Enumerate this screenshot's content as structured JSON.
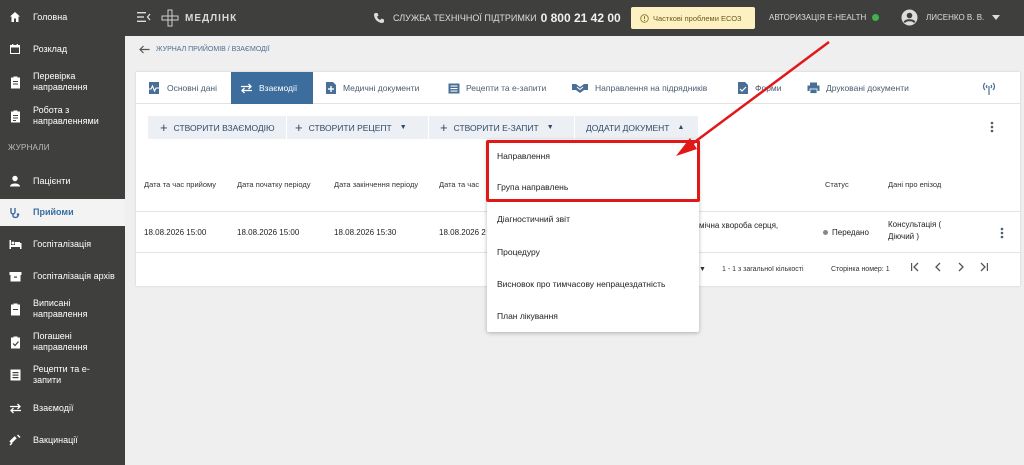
{
  "app": {
    "name": "МЕДЛІНК"
  },
  "sidebar": {
    "items": [
      {
        "label": "Головна",
        "icon": "home-icon"
      },
      {
        "label": "Розклад",
        "icon": "calendar-icon"
      },
      {
        "label": "Перевірка\nнаправлення",
        "icon": "clipboard-icon"
      },
      {
        "label": "Робота з\nнаправленнями",
        "icon": "clipboard-list-icon"
      },
      {
        "label": "Пацієнти",
        "icon": "person-icon"
      },
      {
        "label": "Прийоми",
        "icon": "stethoscope-icon"
      },
      {
        "label": "Госпіталізація",
        "icon": "bed-icon"
      },
      {
        "label": "Госпіталізація архів",
        "icon": "archive-icon"
      },
      {
        "label": "Виписані\nнаправлення",
        "icon": "clipboard-icon"
      },
      {
        "label": "Погашені\nнаправлення",
        "icon": "clipboard-check-icon"
      },
      {
        "label": "Рецепти та е-\nзапити",
        "icon": "list-icon"
      },
      {
        "label": "Взаємодії",
        "icon": "swap-icon"
      },
      {
        "label": "Вакцинації",
        "icon": "syringe-icon"
      }
    ],
    "section_journals": "ЖУРНАЛИ",
    "active_label": "Прийоми"
  },
  "topbar": {
    "support_label": "СЛУЖБА ТЕХНІЧНОЇ ПІДТРИМКИ",
    "phone": "0 800 21 42 00",
    "warning": "Часткові проблеми ЕСОЗ",
    "auth": "АВТОРИЗАЦІЯ E-HEALTH",
    "user": "ЛИСЕНКО В. В."
  },
  "breadcrumb": "ЖУРНАЛ ПРИЙОМІВ / ВЗАЄМОДІЇ",
  "tabs": [
    {
      "label": "Основні дані",
      "icon": "pulse-doc-icon"
    },
    {
      "label": "Взаємодії",
      "icon": "swap-icon",
      "active": true
    },
    {
      "label": "Медичні документи",
      "icon": "medical-doc-icon"
    },
    {
      "label": "Рецепти та е-запити",
      "icon": "list-icon"
    },
    {
      "label": "Направлення на підрядників",
      "icon": "handshake-icon"
    },
    {
      "label": "Форми",
      "icon": "form-icon"
    },
    {
      "label": "Друковані документи",
      "icon": "printer-icon"
    }
  ],
  "toolbar": {
    "create_interaction": "СТВОРИТИ ВЗАЄМОДІЮ",
    "create_recipe": "СТВОРИТИ РЕЦЕПТ",
    "create_erequest": "СТВОРИТИ Е-ЗАПИТ",
    "add_document": "ДОДАТИ ДОКУМЕНТ"
  },
  "table": {
    "headers": {
      "visit_datetime": "Дата та час прийому",
      "period_start": "Дата початку періоду",
      "period_end": "Дата закінчення періоду",
      "datetime4": "Дата та час",
      "status": "Статус",
      "episode": "Дані про епізод"
    },
    "row": {
      "visit_datetime": "18.08.2026 15:00",
      "period_start": "18.08.2026 15:00",
      "period_end": "18.08.2026 15:30",
      "datetime4": "18.08.2026 2",
      "diagnosis": "мічна хвороба серця,",
      "status": "Передано",
      "episode": "Консультація (\nДіючий )"
    }
  },
  "pager": {
    "range": "1 - 1 з загальної кількості",
    "page": "Сторінка номер: 1"
  },
  "dropdown": {
    "items": [
      "Направлення",
      "Група направлень",
      "Діагностичний звіт",
      "Процедуру",
      "Висновок про тимчасову непрацездатність",
      "План лікування"
    ]
  },
  "colors": {
    "sidebar_bg": "#3f3f3d",
    "accent": "#3d6d9c",
    "highlight": "#e01818",
    "warning_bg": "#fdf1c2"
  }
}
